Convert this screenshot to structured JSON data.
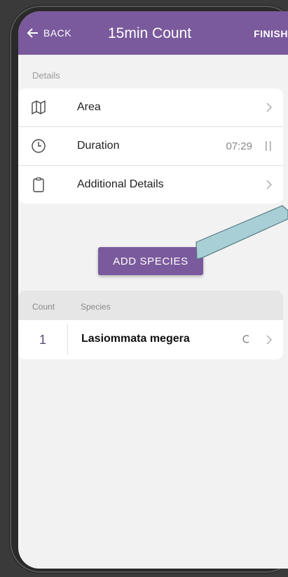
{
  "header": {
    "back_label": "BACK",
    "title": "15min Count",
    "finish_label": "FINISH"
  },
  "details": {
    "section_label": "Details",
    "items": [
      {
        "label": "Area",
        "icon": "map-icon"
      },
      {
        "label": "Duration",
        "icon": "clock-icon",
        "value": "07:29"
      },
      {
        "label": "Additional Details",
        "icon": "clipboard-icon"
      }
    ]
  },
  "add_species_label": "ADD SPECIES",
  "species_list": {
    "headers": {
      "count": "Count",
      "species": "Species"
    },
    "rows": [
      {
        "count": "1",
        "species": "Lasiommata megera"
      }
    ]
  },
  "colors": {
    "accent": "#7a5a9c",
    "annotation_arrow": "#a9cfd6"
  }
}
